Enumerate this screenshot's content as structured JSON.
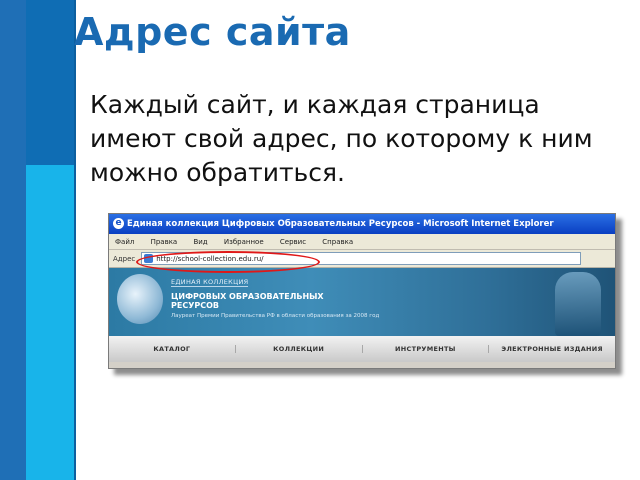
{
  "slide": {
    "title": "Адрес сайта",
    "text": "Каждый сайт, и каждая страница имеют свой адрес, по которому к ним можно обратиться."
  },
  "browser": {
    "window_title": "Единая коллекция Цифровых Образовательных Ресурсов - Microsoft Internet Explorer",
    "menu": [
      "Файл",
      "Правка",
      "Вид",
      "Избранное",
      "Сервис",
      "Справка"
    ],
    "address_label": "Адрес",
    "address_value": "http://school-collection.edu.ru/",
    "site": {
      "collection_label": "ЕДИНАЯ КОЛЛЕКЦИЯ",
      "collection_name": "ЦИФРОВЫХ ОБРАЗОВАТЕЛЬНЫХ РЕСУРСОВ",
      "award_note": "Лауреат Премии Правительства РФ в области образования за 2008 год",
      "nav": [
        "КАТАЛОГ",
        "КОЛЛЕКЦИИ",
        "ИНСТРУМЕНТЫ",
        "ЭЛЕКТРОННЫЕ ИЗДАНИЯ"
      ]
    }
  },
  "colors": {
    "accent": "#1a6ab2",
    "highlight": "#e01818"
  }
}
